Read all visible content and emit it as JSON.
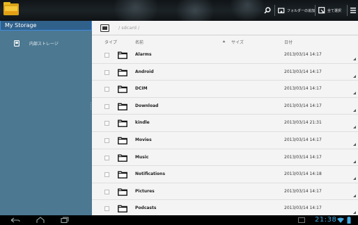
{
  "toolbar": {
    "new_folder_label": "フォルダーの追加",
    "select_all_label": "全て選択"
  },
  "sidebar": {
    "header_title": "My Storage",
    "items": [
      {
        "label": "内部ストレージ",
        "icon": "sd-storage-icon"
      }
    ]
  },
  "path": {
    "text": "/ sdcard /"
  },
  "columns": {
    "type": "タイプ",
    "name": "名前",
    "size": "サイズ",
    "date": "日付"
  },
  "files": [
    {
      "name": "Alarms",
      "date": "2013/03/14 14:17"
    },
    {
      "name": "Android",
      "date": "2013/03/14 14:17"
    },
    {
      "name": "DCIM",
      "date": "2013/03/14 14:17"
    },
    {
      "name": "Download",
      "date": "2013/03/14 14:17"
    },
    {
      "name": "kindle",
      "date": "2013/03/14 21:31"
    },
    {
      "name": "Movies",
      "date": "2013/03/14 14:17"
    },
    {
      "name": "Music",
      "date": "2013/03/14 14:17"
    },
    {
      "name": "Notifications",
      "date": "2013/03/14 14:18"
    },
    {
      "name": "Pictures",
      "date": "2013/03/14 14:17"
    },
    {
      "name": "Podcasts",
      "date": "2013/03/14 14:17"
    }
  ],
  "status": {
    "clock": "21:38"
  },
  "colors": {
    "sidebar_bg": "#4c7891",
    "sidebar_header": "#30618b",
    "accent_blue": "#3d8be0",
    "clock_blue": "#3fa9e0",
    "content_bg": "#f4f4f4"
  }
}
